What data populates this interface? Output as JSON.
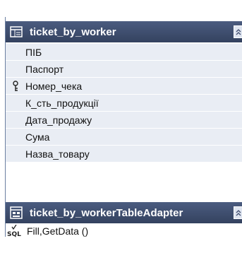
{
  "table": {
    "title": "ticket_by_worker",
    "columns": [
      {
        "name": "ПІБ",
        "is_key": false
      },
      {
        "name": "Паспорт",
        "is_key": false
      },
      {
        "name": "Номер_чека",
        "is_key": true
      },
      {
        "name": "К_сть_продукції",
        "is_key": false
      },
      {
        "name": "Дата_продажу",
        "is_key": false
      },
      {
        "name": "Сума",
        "is_key": false
      },
      {
        "name": "Назва_товару",
        "is_key": false
      }
    ]
  },
  "adapter": {
    "title": "ticket_by_workerTableAdapter",
    "queries": [
      {
        "label": "Fill,GetData ()",
        "icon": "sql-icon"
      }
    ]
  },
  "icons": {
    "table": "table-icon",
    "adapter": "table-adapter-icon",
    "collapse": "collapse-up-icon",
    "key": "key-icon"
  },
  "colors": {
    "header_bg": "#3d4b6d",
    "column_bg": "#e9edf4",
    "text": "#111111"
  }
}
